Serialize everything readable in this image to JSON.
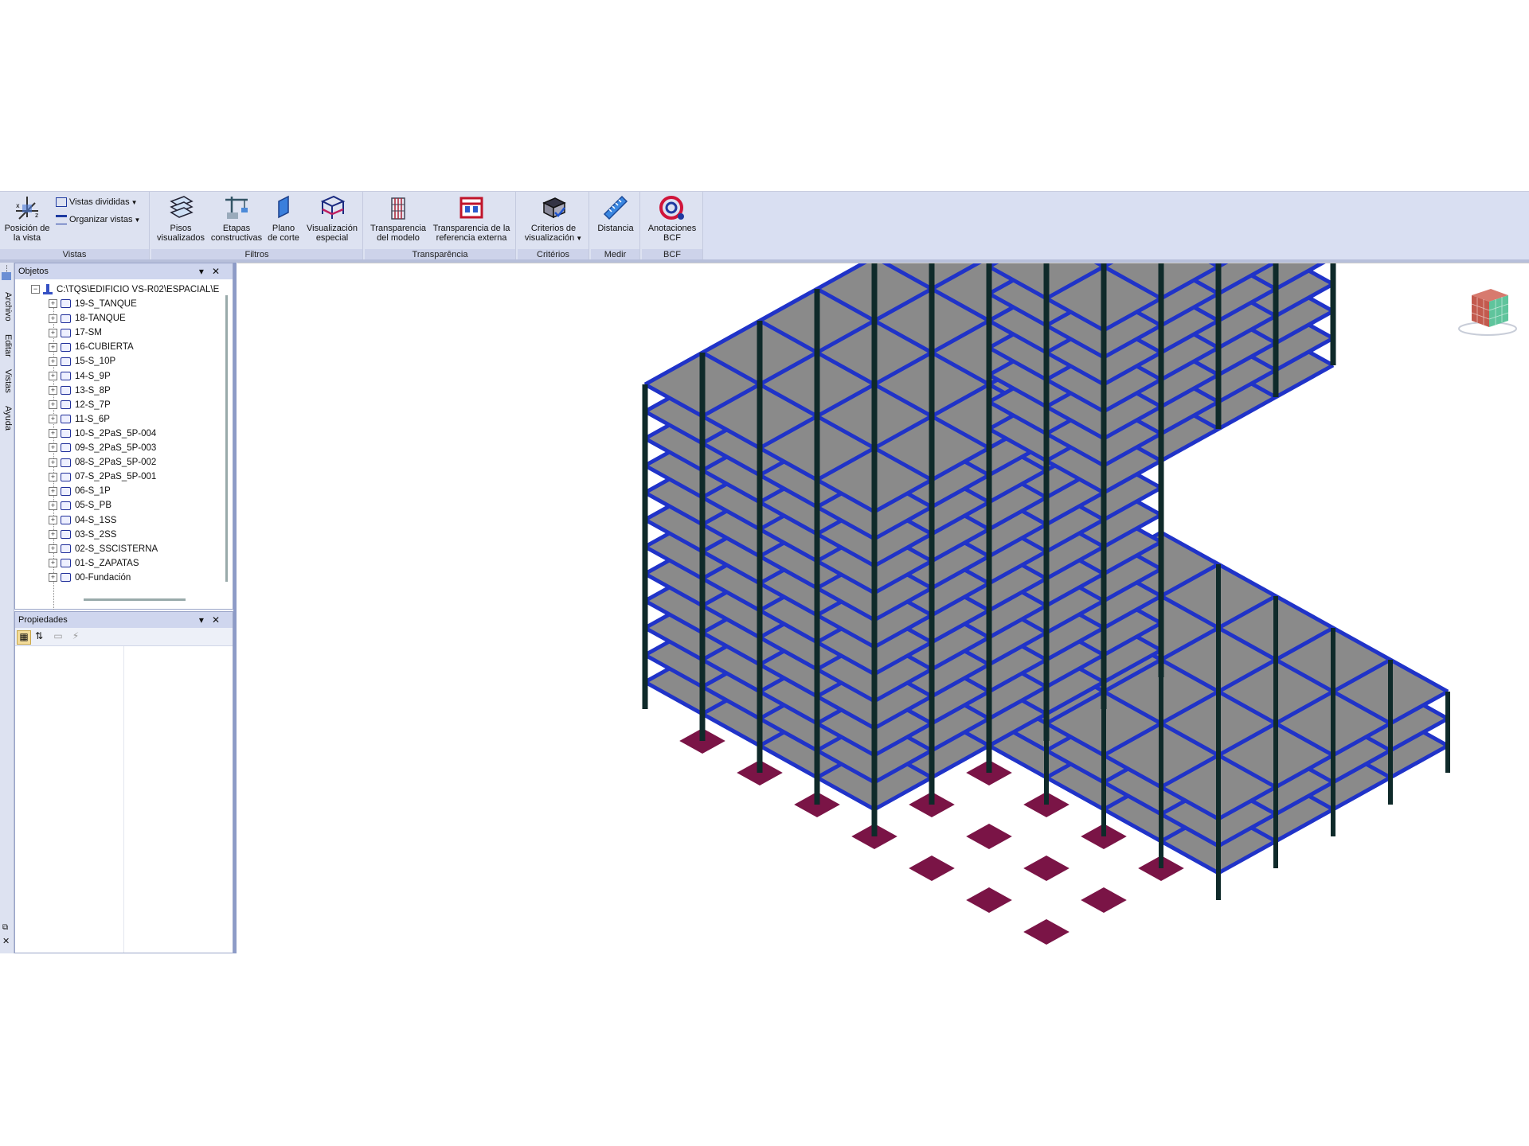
{
  "ribbon": {
    "groups": {
      "vistas": "Vistas",
      "filtros": "Filtros",
      "transparencia": "Transparência",
      "criterios": "Critérios",
      "medir": "Medir",
      "bcf": "BCF"
    },
    "buttons": {
      "posicion_vista": "Posición de\nla vista",
      "vistas_divididas": "Vistas divididas",
      "organizar_vistas": "Organizar vistas",
      "pisos_visualizados": "Pisos\nvisualizados",
      "etapas_constructivas": "Etapas\nconstructivas",
      "plano_corte": "Plano\nde corte",
      "visualizacion_especial": "Visualización\nespecial",
      "transparencia_modelo": "Transparencia\ndel modelo",
      "transparencia_referencia": "Transparencia de la\nreferencia externa",
      "criterios_visualizacion": "Criterios de\nvisualización",
      "distancia": "Distancia",
      "anotaciones_bcf": "Anotaciones\nBCF"
    }
  },
  "rail": {
    "tabs": [
      "Archivo",
      "Editar",
      "Vistas",
      "Ayuda"
    ]
  },
  "objects_panel": {
    "title": "Objetos",
    "root": "C:\\TQS\\EDIFICIO VS-R02\\ESPACIAL\\E",
    "items": [
      "19-S_TANQUE",
      "18-TANQUE",
      "17-SM",
      "16-CUBIERTA",
      "15-S_10P",
      "14-S_9P",
      "13-S_8P",
      "12-S_7P",
      "11-S_6P",
      "10-S_2PaS_5P-004",
      "09-S_2PaS_5P-003",
      "08-S_2PaS_5P-002",
      "07-S_2PaS_5P-001",
      "06-S_1P",
      "05-S_PB",
      "04-S_1SS",
      "03-S_2SS",
      "02-S_SSCISTERNA",
      "01-S_ZAPATAS",
      "00-Fundación"
    ]
  },
  "properties_panel": {
    "title": "Propiedades"
  },
  "colors": {
    "beam": "#2033c8",
    "column": "#0f2a2a",
    "slab": "#8a8a8a",
    "footing": "#7a1446",
    "ribbon": "#dde2f1"
  }
}
